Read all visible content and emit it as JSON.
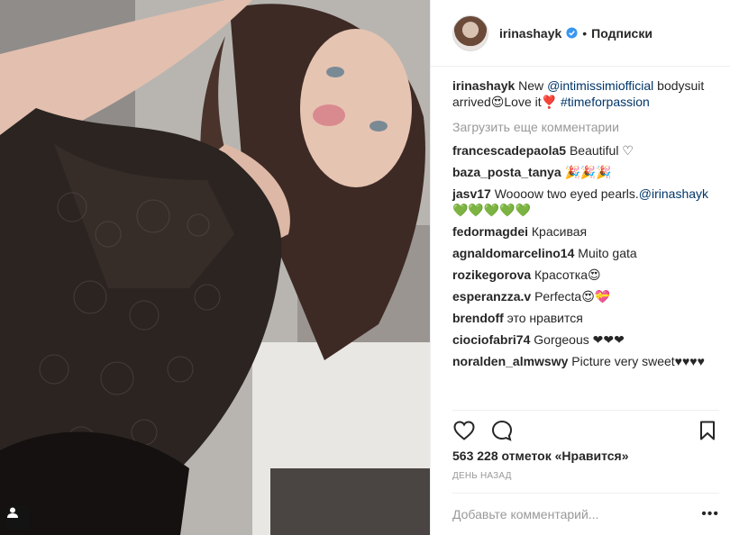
{
  "post": {
    "username": "irinashayk",
    "follow_label": "Подписки",
    "separator": "•",
    "caption_user": "irinashayk",
    "caption_parts": {
      "pre": "New ",
      "mention": "@intimissimiofficial",
      "mid": " bodysuit arrived😍Love it❣️ ",
      "hashtag": "#timeforpassion"
    },
    "load_more": "Загрузить еще комментарии",
    "comments": [
      {
        "user": "francescadepaola5",
        "text": "Beautiful ♡"
      },
      {
        "user": "baza_posta_tanya",
        "text": "🎉🎉🎉"
      },
      {
        "user": "jasv17",
        "text": "Woooow two eyed pearls.",
        "mention": "@irinashayk",
        "tail": " 💚💚💚💚💚"
      },
      {
        "user": "fedormagdei",
        "text": "Красивая"
      },
      {
        "user": "agnaldomarcelino14",
        "text": "Muito gata"
      },
      {
        "user": "rozikegorova",
        "text": "Красотка😍"
      },
      {
        "user": "esperanzza.v",
        "text": "Perfecta😍💝"
      },
      {
        "user": "brendoff",
        "text": "это нравится"
      },
      {
        "user": "ciociofabri74",
        "text": "Gorgeous ❤❤❤"
      },
      {
        "user": "noralden_almwswy",
        "text": "Picture very sweet♥♥♥♥"
      }
    ],
    "likes": "563 228 отметок «Нравится»",
    "time": "ДЕНЬ НАЗАД",
    "comment_placeholder": "Добавьте комментарий...",
    "more_label": "•••"
  },
  "icons": {
    "like": "heart-icon",
    "comment": "comment-bubble-icon",
    "save": "bookmark-icon",
    "verified": "verified-badge-icon",
    "tag": "user-tag-icon"
  },
  "colors": {
    "link": "#003569",
    "muted": "#999999",
    "verified": "#3897f0",
    "divider": "#efefef"
  }
}
